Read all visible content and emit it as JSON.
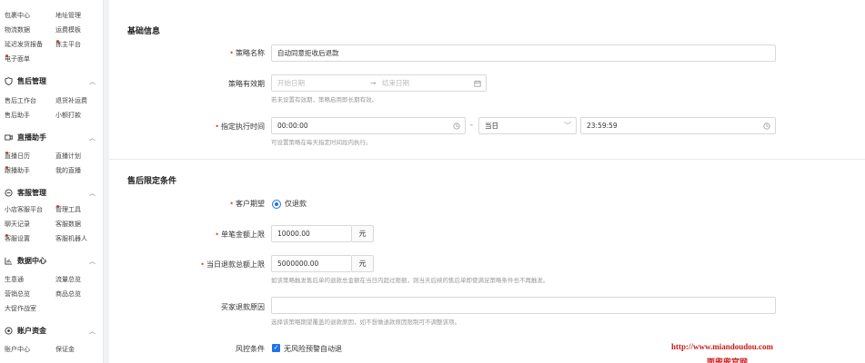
{
  "sidebar": {
    "rows_top": [
      {
        "c1": "包裹中心",
        "c1_dot": false,
        "c2": "地址管理",
        "c2_dot": false
      },
      {
        "c1": "物流数据",
        "c1_dot": false,
        "c2": "运费模板",
        "c2_dot": false
      },
      {
        "c1": "延迟发货报备",
        "c1_dot": false,
        "c2": "拣主平台",
        "c2_dot": true
      },
      {
        "c1": "电子面单",
        "c1_dot": true,
        "c2": "",
        "c2_dot": false
      }
    ],
    "groups": [
      {
        "title": "售后管理",
        "icon": "shield-icon",
        "rows": [
          {
            "c1": "售后工作台",
            "c1_dot": false,
            "c2": "退货补运费",
            "c2_dot": false
          },
          {
            "c1": "售后助手",
            "c1_dot": false,
            "c2": "小额打款",
            "c2_dot": false
          }
        ]
      },
      {
        "title": "直播助手",
        "icon": "video-icon",
        "rows": [
          {
            "c1": "直播日历",
            "c1_dot": true,
            "c2": "直播计划",
            "c2_dot": false
          },
          {
            "c1": "跟播助手",
            "c1_dot": true,
            "c2": "我的直播",
            "c2_dot": false
          }
        ]
      },
      {
        "title": "客服管理",
        "icon": "chat-icon",
        "rows": [
          {
            "c1": "小店客服平台",
            "c1_dot": false,
            "c2": "管理工具",
            "c2_dot": true
          },
          {
            "c1": "聊天记录",
            "c1_dot": false,
            "c2": "客服数据",
            "c2_dot": false
          },
          {
            "c1": "客服设置",
            "c1_dot": true,
            "c2": "客服机器人",
            "c2_dot": false
          }
        ]
      },
      {
        "title": "数据中心",
        "icon": "chart-icon",
        "rows": [
          {
            "c1": "生意通",
            "c1_dot": false,
            "c2": "流量总览",
            "c2_dot": false
          },
          {
            "c1": "营销总览",
            "c1_dot": false,
            "c2": "商品总览",
            "c2_dot": false
          },
          {
            "c1": "大促作战室",
            "c1_dot": false,
            "c2": "",
            "c2_dot": false
          }
        ]
      },
      {
        "title": "账户资金",
        "icon": "wallet-icon",
        "rows": [
          {
            "c1": "账户中心",
            "c1_dot": false,
            "c2": "保证金",
            "c2_dot": false
          }
        ]
      }
    ]
  },
  "basic": {
    "section_title": "基础信息",
    "strategy_name_label": "策略名称",
    "strategy_name_value": "自动同意拒收后退款",
    "validity_label": "策略有效期",
    "start_placeholder": "开始日期",
    "arrow": "→",
    "end_placeholder": "结束日期",
    "validity_hint": "若未设置有效期，策略启用即长期有效。",
    "exec_time_label": "指定执行时间",
    "exec_start_value": "00:00:00",
    "separator": "-",
    "day_select_value": "当日",
    "exec_end_value": "23:59:59",
    "exec_hint": "可设置策略在每天指定时间段内执行。"
  },
  "limits": {
    "section_title": "售后限定条件",
    "customer_expect_label": "客户期望",
    "customer_expect_option": "仅退款",
    "single_amount_label": "单笔金额上限",
    "single_amount_value": "10000.00",
    "single_amount_unit": "元",
    "daily_total_label": "当日退款总额上限",
    "daily_total_value": "5000000.00",
    "daily_total_unit": "元",
    "daily_total_hint": "如该策略触发售后单的退款总金额在当日内超过限额，则当天后续的售后单即使满足策略条件也不再触发。",
    "buyer_reason_label": "买家退款原因",
    "buyer_reason_hint": "选择该策略期望覆盖的退款原因，如不想做退款原因限制可不调整该项。",
    "risk_label": "风控条件",
    "risk_option": "无风险预警自动退"
  },
  "watermark": {
    "url": "http://www.miandoudou.com",
    "text": "面兜兜官网"
  },
  "colors": {
    "accent": "#1e73e8",
    "required": "#e84040",
    "watermark": "#c81b1b"
  }
}
